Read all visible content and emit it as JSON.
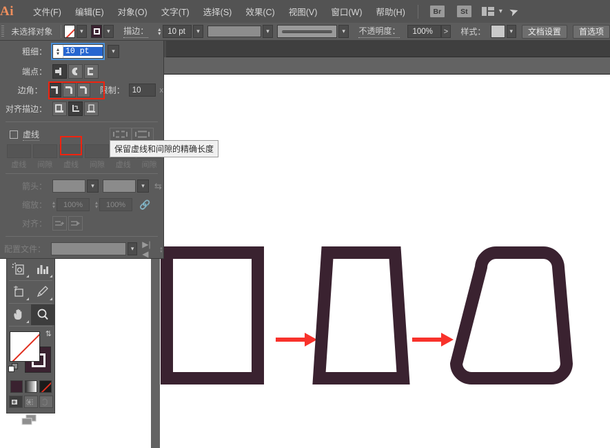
{
  "app": {
    "logo": "Ai"
  },
  "menubar": {
    "items": [
      {
        "label": "文件(F)",
        "name": "menu-file"
      },
      {
        "label": "编辑(E)",
        "name": "menu-edit"
      },
      {
        "label": "对象(O)",
        "name": "menu-object"
      },
      {
        "label": "文字(T)",
        "name": "menu-type"
      },
      {
        "label": "选择(S)",
        "name": "menu-select"
      },
      {
        "label": "效果(C)",
        "name": "menu-effect"
      },
      {
        "label": "视图(V)",
        "name": "menu-view"
      },
      {
        "label": "窗口(W)",
        "name": "menu-window"
      },
      {
        "label": "帮助(H)",
        "name": "menu-help"
      }
    ],
    "bridge_label": "Br",
    "stock_label": "St",
    "arrange_icon": "arrange-documents-icon",
    "chevron_icon": "chevron-down-icon",
    "rocket_icon": "rocket-icon"
  },
  "controlbar": {
    "selection_status": "未选择对象",
    "fill_swatch": "none-swatch-icon",
    "stroke_swatch": "stroke-swatch-icon",
    "stroke_label": "描边：",
    "stroke_weight": "10 pt",
    "brush_definition": "brush-profile-preview",
    "opacity_label": "不透明度：",
    "opacity_value": "100%",
    "opacity_arrow": ">",
    "style_label": "样式：",
    "doc_setup_button": "文档设置",
    "preferences_button": "首选项"
  },
  "stroke_panel": {
    "weight_label": "粗细：",
    "weight_value": "10 pt",
    "cap_label": "端点：",
    "cap_options": [
      "butt-cap-icon",
      "round-cap-icon",
      "projecting-cap-icon"
    ],
    "cap_selected_index": 0,
    "corner_label": "边角：",
    "corner_options": [
      "miter-join-icon",
      "round-join-icon",
      "bevel-join-icon"
    ],
    "corner_selected_index": 0,
    "limit_label": "限制：",
    "limit_value": "10",
    "limit_unit": "x",
    "align_label": "对齐描边：",
    "align_options": [
      "align-stroke-center-icon",
      "align-stroke-inside-icon",
      "align-stroke-outside-icon"
    ],
    "align_selected_index": 1,
    "dashed_label": "虚线",
    "dashed_checked": false,
    "dash_preserve_options": [
      "dash-exact-length-icon",
      "dash-fit-corners-icon"
    ],
    "dash_fields": [
      {
        "value": "",
        "caption": "虚线"
      },
      {
        "value": "",
        "caption": "间隙"
      },
      {
        "value": "",
        "caption": "虚线"
      },
      {
        "value": "",
        "caption": "间隙"
      },
      {
        "value": "",
        "caption": "虚线"
      },
      {
        "value": "",
        "caption": "间隙"
      }
    ],
    "arrow_label": "箭头：",
    "arrow_swap_icon": "swap-arrows-icon",
    "scale_label": "缩放：",
    "scale_start": "100%",
    "scale_end": "100%",
    "scale_link_icon": "broken-link-icon",
    "align_arrow_label": "对齐：",
    "align_arrow_options": [
      "extend-arrow-beyond-end-icon",
      "place-arrow-at-end-icon"
    ],
    "profile_label": "配置文件：",
    "profile_flip_across_icon": "flip-across-icon",
    "profile_flip_along_icon": "flip-along-icon"
  },
  "tooltip": {
    "text": "保留虚线和间隙的精确长度"
  },
  "tools": {
    "rows": [
      [
        "symbol-sprayer-tool-icon",
        "column-graph-tool-icon"
      ],
      [
        "artboard-tool-icon",
        "slice-tool-icon"
      ],
      [
        "hand-tool-icon",
        "zoom-tool-icon"
      ]
    ],
    "selected_tool": "zoom-tool-icon",
    "fill_swatch": "fill-none-icon",
    "stroke_swatch": "stroke-plum-icon",
    "swap_icon": "swap-fill-stroke-icon",
    "default_icon": "default-fill-stroke-icon",
    "color_modes": [
      "color-solid-icon",
      "gradient-icon",
      "none-icon"
    ],
    "draw_modes": [
      "draw-normal-icon",
      "draw-behind-icon",
      "draw-inside-icon"
    ],
    "draw_selected_index": 0,
    "screen_mode_icon": "screen-mode-icon"
  },
  "artwork": {
    "stroke_color": "#3a2230",
    "arrow_color": "#f8322b",
    "shapes": [
      {
        "name": "rectangle-shape",
        "label": "rectangle"
      },
      {
        "name": "trapezoid-shape",
        "label": "trapezoid"
      },
      {
        "name": "rounded-trapezoid-shape",
        "label": "rounded trapezoid"
      }
    ],
    "arrows": [
      {
        "name": "transform-arrow-1"
      },
      {
        "name": "transform-arrow-2"
      }
    ]
  }
}
